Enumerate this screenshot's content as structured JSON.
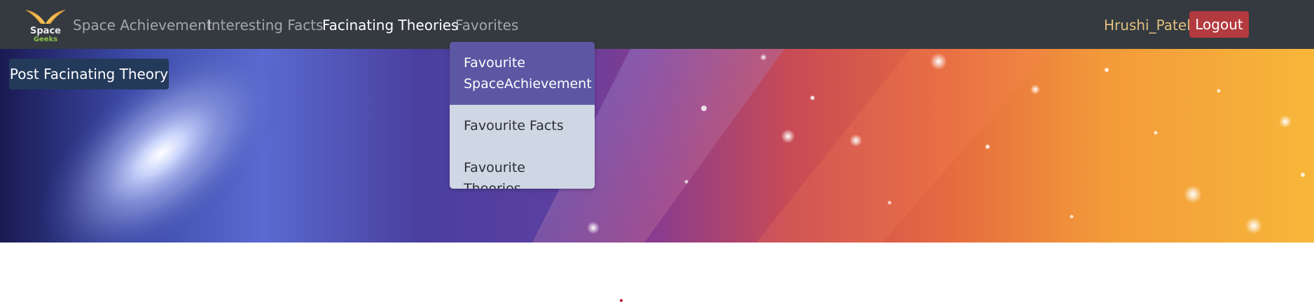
{
  "brand": {
    "line1": "Space",
    "line2": "Geeks",
    "icon": "wings-logo-icon"
  },
  "nav": {
    "items": [
      {
        "label": "Space Achievement"
      },
      {
        "label": "Interesting Facts"
      },
      {
        "label": "Facinating Theories"
      },
      {
        "label": "Favorites"
      }
    ],
    "active_index": 2
  },
  "user": {
    "name": "Hrushi_Patel",
    "logout_label": "Logout"
  },
  "hero": {
    "post_button_label": "Post Facinating Theory"
  },
  "favorites_dropdown": {
    "items": [
      {
        "label": "Favourite SpaceAchievement"
      },
      {
        "label": "Favourite Facts"
      },
      {
        "label": "Favourite Theories"
      }
    ],
    "highlighted_index": 0
  },
  "colors": {
    "navbar_bg": "#343a40",
    "user_name": "#e2c07e",
    "logout_bg": "#b33a3f",
    "dropdown_bg": "#cfd7e5",
    "dropdown_highlight": "#5b57a3",
    "post_button_bg": "#243a5b"
  }
}
